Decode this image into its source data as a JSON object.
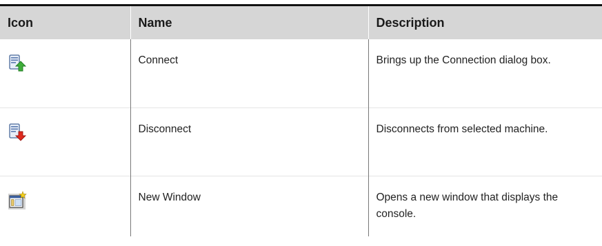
{
  "table": {
    "headers": {
      "icon": "Icon",
      "name": "Name",
      "description": "Description"
    },
    "rows": [
      {
        "icon": "connect-icon",
        "name": "Connect",
        "description": "Brings up the Connection dialog box."
      },
      {
        "icon": "disconnect-icon",
        "name": "Disconnect",
        "description": "Disconnects from selected machine."
      },
      {
        "icon": "new-window-icon",
        "name": "New Window",
        "description": "Opens a new window that displays the console."
      }
    ]
  }
}
